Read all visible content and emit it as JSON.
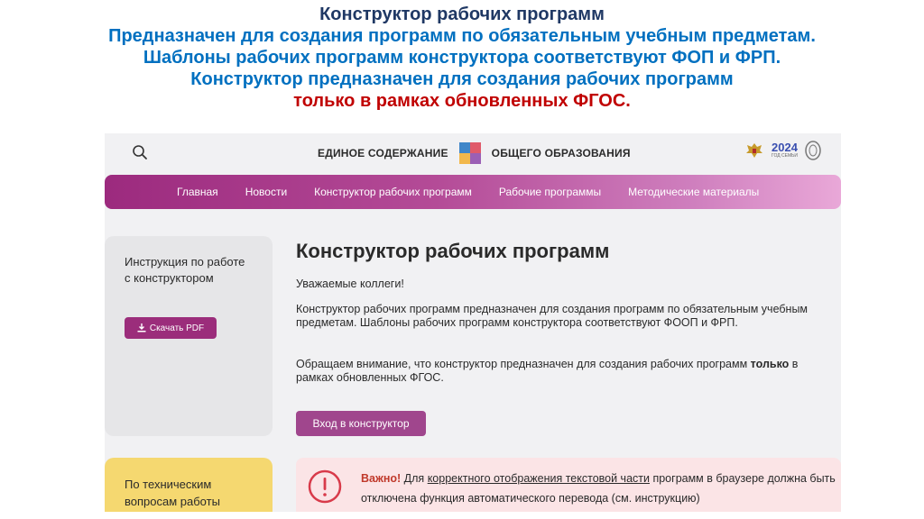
{
  "slide": {
    "line1": "Конструктор рабочих программ",
    "line2": "Предназначен для создания программ по обязательным учебным предметам.",
    "line3": "Шаблоны рабочих программ конструктора  соответствуют ФОП и ФРП.",
    "line4": "Конструктор предназначен для создания рабочих программ",
    "line5": "только в рамках обновленных ФГОС."
  },
  "header": {
    "brand_left": "ЕДИНОЕ СОДЕРЖАНИЕ",
    "brand_right": "ОБЩЕГО ОБРАЗОВАНИЯ",
    "year_badge": "2024",
    "year_caption": "ГОД СЕМЬИ"
  },
  "nav": {
    "items": [
      "Главная",
      "Новости",
      "Конструктор рабочих программ",
      "Рабочие программы",
      "Методические материалы"
    ]
  },
  "sidebar": {
    "title": "Инструкция по работе с конструктором",
    "download_label": "Скачать PDF",
    "support_title": "По техническим вопросам работы"
  },
  "main": {
    "title": "Конструктор рабочих программ",
    "greeting": "Уважаемые коллеги!",
    "paragraph1": "Конструктор рабочих программ предназначен для создания программ по обязательным учебным предметам. Шаблоны рабочих программ конструктора  соответствуют ФООП и ФРП.",
    "paragraph2_start": "Обращаем внимание, что  конструктор предназначен для создания рабочих программ ",
    "paragraph2_bold": "только",
    "paragraph2_end": " в рамках обновленных ФГОС.",
    "enter_label": "Вход в конструктор"
  },
  "alert": {
    "strong": "Важно!",
    "text1": " Для ",
    "link": "корректного отображения текстовой части",
    "text2": " программ в браузере должна быть отключена функция автоматического перевода (см. инструкцию)"
  },
  "colors": {
    "nav_gradient_start": "#9c2a7e",
    "nav_gradient_end": "#e9a8d8",
    "button": "#9b2d7b",
    "support_card": "#f5d870",
    "alert_bg": "#fbe4e6",
    "alert_accent": "#d83a4a"
  }
}
